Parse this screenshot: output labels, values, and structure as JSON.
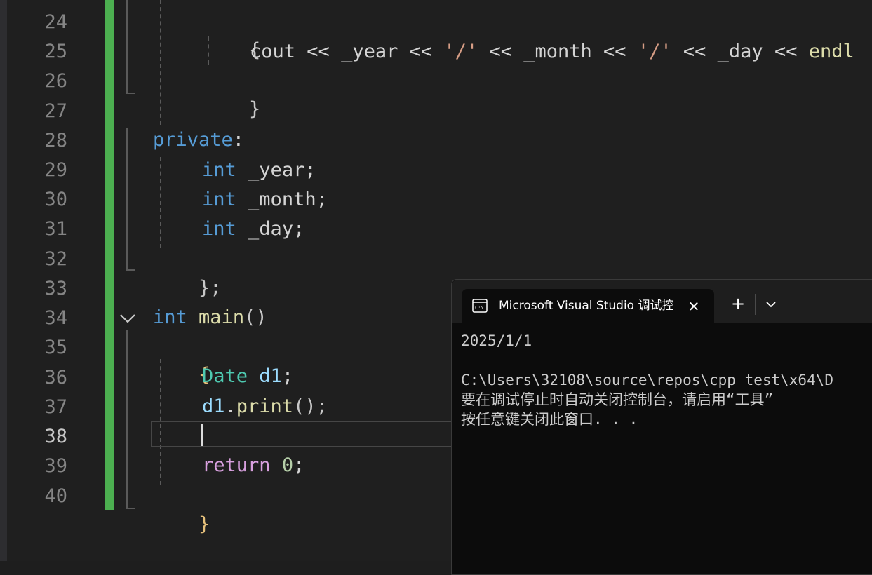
{
  "editor": {
    "line_numbers": [
      "24",
      "25",
      "26",
      "27",
      "28",
      "29",
      "30",
      "31",
      "32",
      "33",
      "34",
      "35",
      "36",
      "37",
      "38",
      "39",
      "40"
    ],
    "current_line": "38",
    "code": {
      "l24": "{",
      "l25_cout": "cout",
      "l25_op": "<<",
      "l25_year": "_year",
      "l25_str": "'/'",
      "l25_month": "_month",
      "l25_day": "_day",
      "l25_endl": "endl",
      "l26": "}",
      "l28_kw": "private",
      "l28_colon": ":",
      "int_kw": "int",
      "l29_var": "_year;",
      "l30_var": "_month;",
      "l31_var": "_day;",
      "l32": "};",
      "l34_main": "main",
      "l34_parens": "()",
      "l35": "{",
      "l36_type": "Date",
      "l36_var": "d1",
      "l36_semi": ";",
      "l37_var": "d1",
      "l37_dot": ".",
      "l37_fn": "print",
      "l37_rest": "();",
      "l39_kw": "return",
      "l39_num": "0",
      "l39_semi": ";",
      "l40": "}"
    }
  },
  "terminal": {
    "tab_title": "Microsoft Visual Studio 调试控",
    "tab_icon": "console-icon",
    "close_glyph": "✕",
    "new_tab_glyph": "+",
    "output_lines": [
      "2025/1/1",
      "",
      "C:\\Users\\32108\\source\\repos\\cpp_test\\x64\\D",
      "要在调试停止时自动关闭控制台，请启用“工具”",
      "按任意键关闭此窗口. . ."
    ]
  },
  "colors": {
    "background": "#1f1f1f",
    "change_bar": "#4caf50",
    "keyword": "#569cd6",
    "type": "#4ec9b0",
    "function": "#dcdcaa",
    "variable": "#9cdcfe",
    "control": "#d8a0df"
  }
}
